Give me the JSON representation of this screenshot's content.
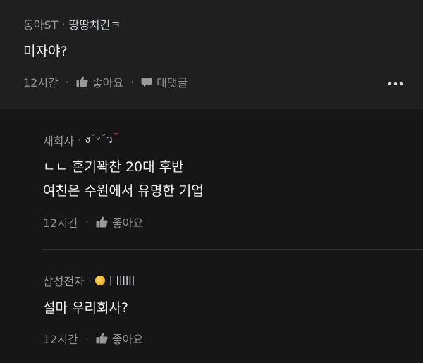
{
  "top_comment": {
    "author": "동아ST",
    "nickname": "땅땅치킨ㅋ",
    "text": "미자야?",
    "time": "12시간",
    "like_label": "좋아요",
    "reply_label": "대댓글"
  },
  "replies": [
    {
      "author": "새회사",
      "nickname": "ง˘ᵕ˘ว",
      "lines": [
        "ㄴㄴ 혼기꽉찬 20대 후반",
        "여친은 수원에서 유명한 기업"
      ],
      "time": "12시간",
      "like_label": "좋아요"
    },
    {
      "author": "삼성전자",
      "nickname": "i iilili",
      "lines": [
        "설마 우리회사?"
      ],
      "time": "12시간",
      "like_label": "좋아요"
    }
  ],
  "icons": {
    "like": "thumbs-up-icon",
    "reply": "speech-bubble-icon",
    "more": "more-dots-icon",
    "badge": "gold-badge-icon"
  },
  "colors": {
    "top_bg": "#1f1f1f",
    "reply_bg": "#161616",
    "accent_star": "#e64545"
  }
}
